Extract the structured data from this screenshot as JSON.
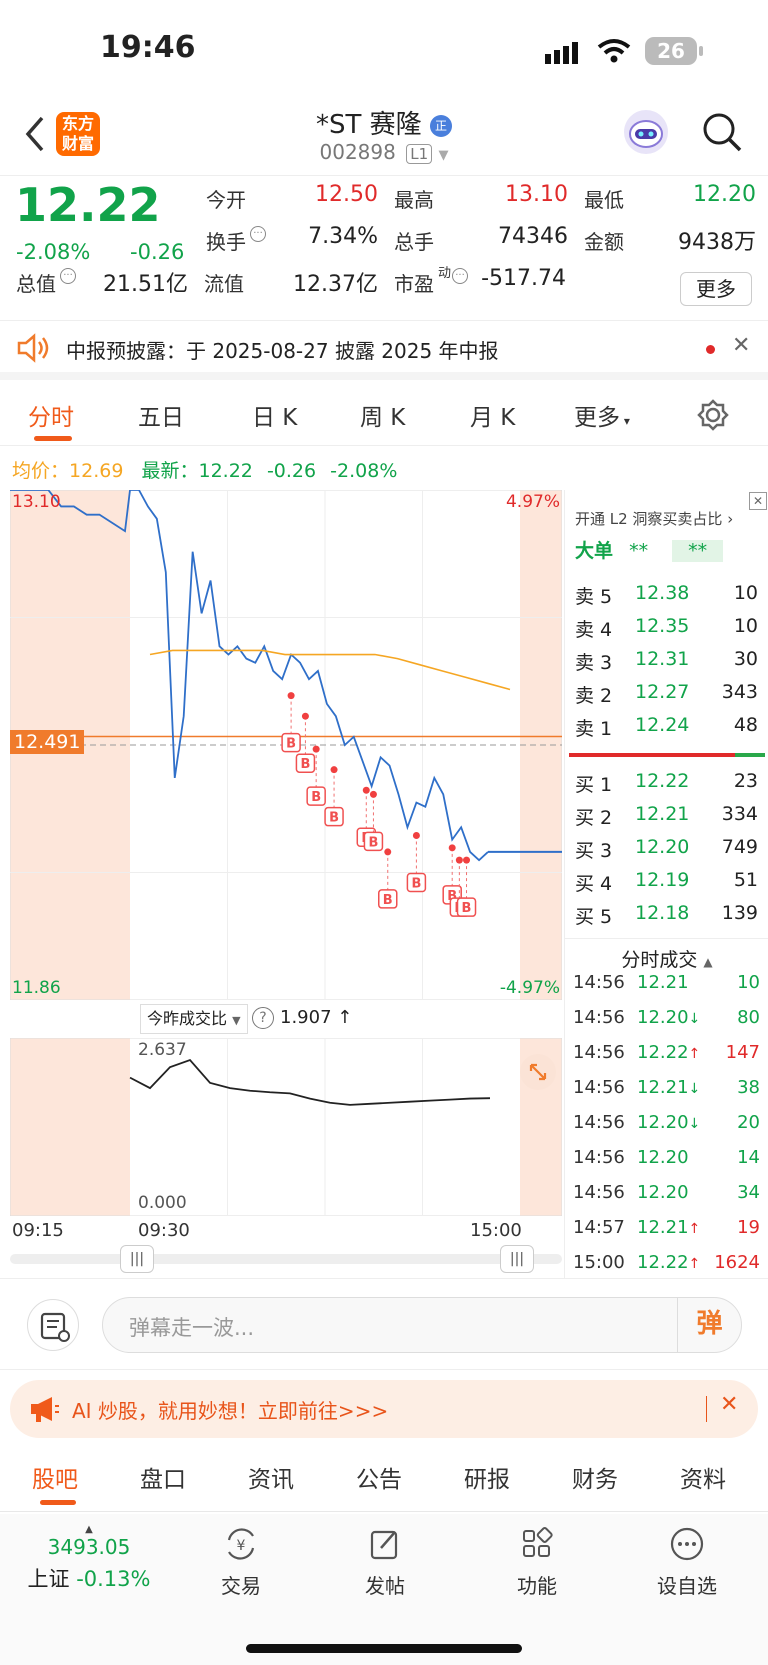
{
  "status_bar": {
    "time": "19:46",
    "battery": "26"
  },
  "header": {
    "logo_text": "东方财富",
    "title": "*ST 赛隆",
    "badge": "正",
    "code": "002898",
    "level": "L1"
  },
  "quote": {
    "price": "12.22",
    "change_pct": "-2.08%",
    "change": "-0.26",
    "stats": [
      {
        "label": "今开",
        "value": "12.50",
        "color": "#e02a2a"
      },
      {
        "label": "最高",
        "value": "13.10",
        "color": "#e02a2a"
      },
      {
        "label": "最低",
        "value": "12.20",
        "color": "#11a34a"
      },
      {
        "label": "换手",
        "value": "7.34%",
        "color": "#222"
      },
      {
        "label": "总手",
        "value": "74346",
        "color": "#222"
      },
      {
        "label": "金额",
        "value": "9438万",
        "color": "#222"
      },
      {
        "label": "总值",
        "value": "21.51亿",
        "color": "#222"
      },
      {
        "label": "流值",
        "value": "12.37亿",
        "color": "#222"
      },
      {
        "label": "市盈",
        "value": "-517.74",
        "color": "#222"
      }
    ],
    "pe_sup": "动",
    "more_label": "更多"
  },
  "notice": {
    "text": "中报预披露：于 2025-08-27 披露 2025 年中报"
  },
  "chart_tabs": [
    "分时",
    "五日",
    "日 K",
    "周 K",
    "月 K",
    "更多"
  ],
  "legend": {
    "avg_label": "均价：",
    "avg_value": "12.69",
    "latest_label": "最新：",
    "latest_value": "12.22",
    "latest_change": "-0.26",
    "latest_pct": "-2.08%"
  },
  "chart_labels": {
    "top_left": "13.10",
    "top_right": "4.97%",
    "bottom_left": "11.86",
    "bottom_right": "-4.97%",
    "cursor_price": "12.491",
    "ratio_selector": "今昨成交比",
    "ratio_value": "1.907",
    "ratio_arrow": "↑",
    "sub_top": "2.637",
    "sub_bottom": "0.000",
    "time_start": "09:15",
    "time_open": "09:30",
    "time_end": "15:00",
    "buy_marker": "B"
  },
  "chart_data": {
    "type": "line",
    "ylim": [
      11.86,
      13.1
    ],
    "prev_close": 12.48,
    "series": [
      {
        "name": "价格",
        "color": "#2f6fc9",
        "values": [
          13.1,
          13.1,
          13.06,
          13.03,
          12.9,
          12.4,
          12.55,
          12.95,
          12.8,
          12.88,
          12.72,
          12.7,
          12.72,
          12.69,
          12.68,
          12.72,
          12.66,
          12.64,
          12.7,
          12.68,
          12.64,
          12.66,
          12.58,
          12.55,
          12.48,
          12.5,
          12.44,
          12.38,
          12.45,
          12.43,
          12.36,
          12.28,
          12.34,
          12.33,
          12.4,
          12.36,
          12.25,
          12.28,
          12.22,
          12.2,
          12.22
        ]
      },
      {
        "name": "均价",
        "color": "#f5a623",
        "values": [
          12.7,
          12.71,
          12.71,
          12.71,
          12.71,
          12.71,
          12.7,
          12.7,
          12.7,
          12.7,
          12.7,
          12.69,
          12.69,
          12.69,
          12.69,
          12.69,
          12.69
        ]
      }
    ],
    "sub_series": {
      "name": "今昨成交比",
      "ylim": [
        0,
        2.637
      ],
      "values": [
        2.3,
        2.1,
        2.5,
        2.637,
        2.2,
        2.1,
        2.05,
        2.02,
        2.0,
        1.9,
        1.82,
        1.78,
        1.8,
        1.82,
        1.84,
        1.86,
        1.88,
        1.9,
        1.907
      ]
    },
    "buy_points": [
      {
        "x": 0.45,
        "y": 12.6
      },
      {
        "x": 0.49,
        "y": 12.55
      },
      {
        "x": 0.52,
        "y": 12.47
      },
      {
        "x": 0.57,
        "y": 12.42
      },
      {
        "x": 0.66,
        "y": 12.37
      },
      {
        "x": 0.68,
        "y": 12.36
      },
      {
        "x": 0.72,
        "y": 12.22
      },
      {
        "x": 0.8,
        "y": 12.26
      },
      {
        "x": 0.9,
        "y": 12.23
      },
      {
        "x": 0.92,
        "y": 12.2
      },
      {
        "x": 0.94,
        "y": 12.2
      }
    ]
  },
  "order_book": {
    "promo": "开通 L2 洞察买卖占比",
    "big_label": "大单",
    "big_v1": "**",
    "big_v2": "**",
    "asks": [
      {
        "label": "卖 5",
        "price": "12.38",
        "vol": "10"
      },
      {
        "label": "卖 4",
        "price": "12.35",
        "vol": "10"
      },
      {
        "label": "卖 3",
        "price": "12.31",
        "vol": "30"
      },
      {
        "label": "卖 2",
        "price": "12.27",
        "vol": "343"
      },
      {
        "label": "卖 1",
        "price": "12.24",
        "vol": "48"
      }
    ],
    "bids": [
      {
        "label": "买 1",
        "price": "12.22",
        "vol": "23"
      },
      {
        "label": "买 2",
        "price": "12.21",
        "vol": "334"
      },
      {
        "label": "买 3",
        "price": "12.20",
        "vol": "749"
      },
      {
        "label": "买 4",
        "price": "12.19",
        "vol": "51"
      },
      {
        "label": "买 5",
        "price": "12.18",
        "vol": "139"
      }
    ],
    "ticks_title": "分时成交",
    "ticks": [
      {
        "time": "14:56",
        "price": "12.21",
        "dir": "",
        "vol": "10",
        "color": "#11a34a"
      },
      {
        "time": "14:56",
        "price": "12.20",
        "dir": "↓",
        "vol": "80",
        "color": "#11a34a"
      },
      {
        "time": "14:56",
        "price": "12.22",
        "dir": "↑",
        "vol": "147",
        "color": "#e02a2a"
      },
      {
        "time": "14:56",
        "price": "12.21",
        "dir": "↓",
        "vol": "38",
        "color": "#11a34a"
      },
      {
        "time": "14:56",
        "price": "12.20",
        "dir": "↓",
        "vol": "20",
        "color": "#11a34a"
      },
      {
        "time": "14:56",
        "price": "12.20",
        "dir": "",
        "vol": "14",
        "color": "#11a34a"
      },
      {
        "time": "14:56",
        "price": "12.20",
        "dir": "",
        "vol": "34",
        "color": "#11a34a"
      },
      {
        "time": "14:57",
        "price": "12.21",
        "dir": "↑",
        "vol": "19",
        "color": "#e02a2a"
      },
      {
        "time": "15:00",
        "price": "12.22",
        "dir": "↑",
        "vol": "1624",
        "color": "#e02a2a"
      }
    ]
  },
  "comment_bar": {
    "placeholder": "弹幕走一波...",
    "danmu": "弹"
  },
  "ai_banner": {
    "text": "AI 炒股，就用妙想！立即前往>>>"
  },
  "bottom_tabs": [
    "股吧",
    "盘口",
    "资讯",
    "公告",
    "研报",
    "财务",
    "资料"
  ],
  "dock": {
    "index_value": "3493.05",
    "index_name": "上证",
    "index_change": "-0.13%",
    "items": [
      "交易",
      "发帖",
      "功能",
      "设自选"
    ]
  }
}
